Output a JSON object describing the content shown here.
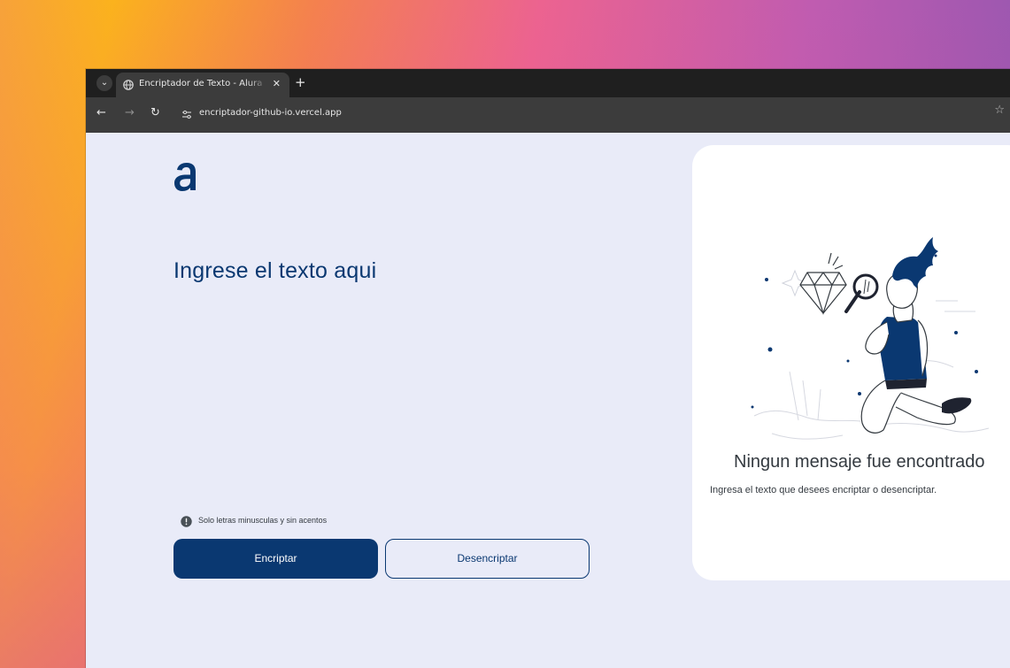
{
  "browser": {
    "tab_title": "Encriptador de Texto - Alura",
    "tab_close_icon": "close-icon",
    "new_tab_label": "+",
    "url": "encriptador-github-io.vercel.app",
    "icons": [
      "chevron-down-icon",
      "globe-icon",
      "back-icon",
      "forward-icon",
      "reload-icon",
      "site-settings-icon",
      "star-icon"
    ]
  },
  "app": {
    "logo_icon": "alura-logo-icon",
    "input_placeholder": "Ingrese el texto aqui",
    "hint_text": "Solo letras minusculas y sin acentos",
    "hint_icon": "info-icon",
    "encrypt_label": "Encriptar",
    "decrypt_label": "Desencriptar"
  },
  "result": {
    "empty_title": "Ningun mensaje fue encontrado",
    "empty_subtitle": "Ingresa el texto que desees encriptar o desencriptar.",
    "illustration": "person-with-magnifier-illustration"
  },
  "colors": {
    "primary": "#0a3871",
    "page_bg": "#e9ebf8",
    "card_bg": "#ffffff",
    "text": "#343a40"
  }
}
